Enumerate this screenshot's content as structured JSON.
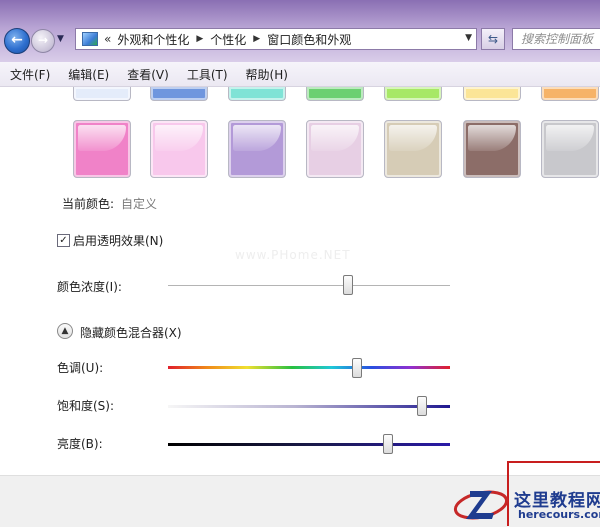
{
  "window": {
    "search_placeholder": "搜索控制面板",
    "breadcrumb": {
      "lead": "«",
      "items": [
        "外观和个性化",
        "个性化",
        "窗口颜色和外观"
      ]
    }
  },
  "menu": {
    "items": [
      "文件(F)",
      "编辑(E)",
      "查看(V)",
      "工具(T)",
      "帮助(H)"
    ]
  },
  "swatches": {
    "top_row_colors": [
      "#e4ecfa",
      "#6f96de",
      "#7fe3d6",
      "#6cd071",
      "#a7e866",
      "#fbe597",
      "#f6b368"
    ],
    "colors": [
      "#f082c8",
      "#f8c8ec",
      "#b39ad8",
      "#e7cfe4",
      "#d6ccb6",
      "#8c6d68",
      "#c8c8cc"
    ]
  },
  "current_color": {
    "label": "当前颜色:",
    "value": "自定义"
  },
  "transparency": {
    "label": "启用透明效果(N)",
    "checked": true
  },
  "intensity": {
    "label": "颜色浓度(I):",
    "value_fraction": 0.64
  },
  "mixer": {
    "toggle_label": "隐藏颜色混合器(X)",
    "hue": {
      "label": "色调(U):",
      "value_fraction": 0.67
    },
    "saturation": {
      "label": "饱和度(S):",
      "value_fraction": 0.9
    },
    "brightness": {
      "label": "亮度(B):",
      "value_fraction": 0.78
    }
  },
  "watermark": "www.PHome.NET",
  "site_logo": {
    "title": "这里教程网",
    "url": "herecours.com"
  }
}
